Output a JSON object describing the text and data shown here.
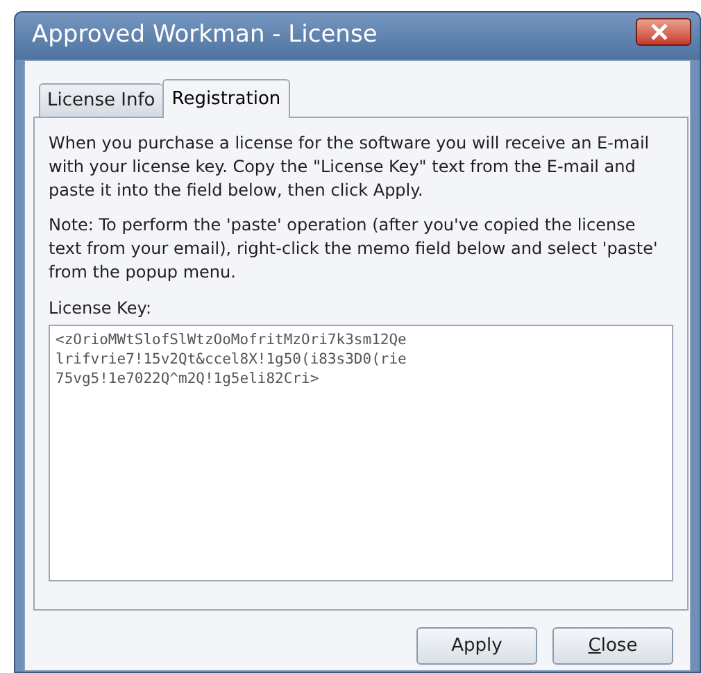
{
  "window": {
    "title": "Approved Workman - License"
  },
  "tabs": [
    {
      "label": "License Info",
      "selected": false
    },
    {
      "label": "Registration",
      "selected": true
    }
  ],
  "instructions": "When you purchase a license for the software you will receive an E-mail with your license key.  Copy the \"License Key\" text from the E-mail and paste it into the field below, then click Apply.",
  "note": "Note: To perform the 'paste' operation (after you've copied the license text from your email), right-click the memo field below and select 'paste' from the popup menu.",
  "license_key": {
    "label": "License Key:",
    "value": "<zOrioMWtSlofSlWtzOoMofritMzOri7k3sm12Qe\nlrifvrie7!15v2Qt&ccel8X!1g50(i83s3D0(rie\n75vg5!1e7022Q^m2Q!1g5eli82Cri>"
  },
  "buttons": [
    {
      "label": "Apply",
      "first_letter_underlined": false
    },
    {
      "label": "Close",
      "first_letter_underlined": true
    }
  ]
}
